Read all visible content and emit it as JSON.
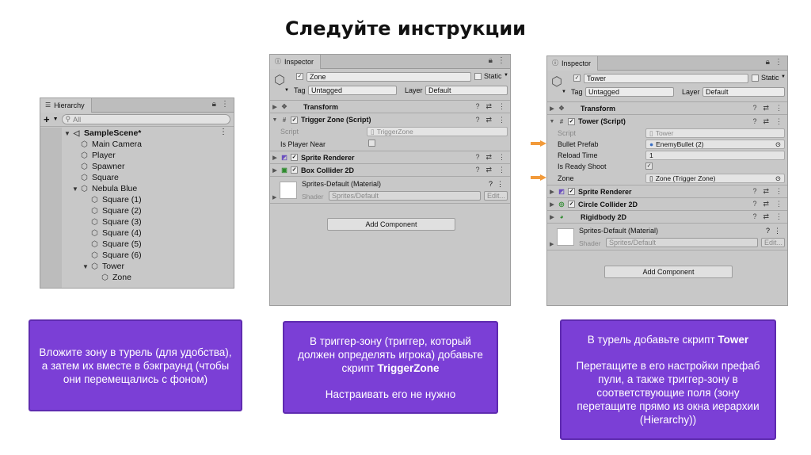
{
  "title": "Следуйте инструкции",
  "hierarchy": {
    "tab_label": "Hierarchy",
    "search_placeholder": "All",
    "items": [
      {
        "label": "SampleScene*"
      },
      {
        "label": "Main Camera"
      },
      {
        "label": "Player"
      },
      {
        "label": "Spawner"
      },
      {
        "label": "Square"
      },
      {
        "label": "Nebula Blue"
      },
      {
        "label": "Square (1)"
      },
      {
        "label": "Square (2)"
      },
      {
        "label": "Square (3)"
      },
      {
        "label": "Square (4)"
      },
      {
        "label": "Square (5)"
      },
      {
        "label": "Square (6)"
      },
      {
        "label": "Tower"
      },
      {
        "label": "Zone"
      }
    ]
  },
  "inspector1": {
    "tab_label": "Inspector",
    "object_name": "Zone",
    "static_label": "Static",
    "tag_label": "Tag",
    "tag_value": "Untagged",
    "layer_label": "Layer",
    "layer_value": "Default",
    "components": {
      "transform": "Transform",
      "trigger_zone": "Trigger Zone (Script)",
      "sprite_renderer": "Sprite Renderer",
      "box_collider": "Box Collider 2D"
    },
    "script_label": "Script",
    "script_value": "TriggerZone",
    "is_player_near_label": "Is Player Near",
    "material_name": "Sprites-Default (Material)",
    "shader_label": "Shader",
    "shader_value": "Sprites/Default",
    "edit_label": "Edit...",
    "add_component": "Add Component"
  },
  "inspector2": {
    "tab_label": "Inspector",
    "object_name": "Tower",
    "static_label": "Static",
    "tag_label": "Tag",
    "tag_value": "Untagged",
    "layer_label": "Layer",
    "layer_value": "Default",
    "components": {
      "transform": "Transform",
      "tower_script": "Tower (Script)",
      "sprite_renderer": "Sprite Renderer",
      "circle_collider": "Circle Collider 2D",
      "rigidbody": "Rigidbody 2D"
    },
    "script_label": "Script",
    "script_value": "Tower",
    "bullet_prefab_label": "Bullet Prefab",
    "bullet_prefab_value": "EnemyBullet (2)",
    "reload_time_label": "Reload Time",
    "reload_time_value": "1",
    "is_ready_shoot_label": "Is Ready Shoot",
    "zone_label": "Zone",
    "zone_value": "Zone (Trigger Zone)",
    "material_name": "Sprites-Default (Material)",
    "shader_label": "Shader",
    "shader_value": "Sprites/Default",
    "edit_label": "Edit...",
    "add_component": "Add Component"
  },
  "callouts": {
    "c1": "Вложите зону в турель (для удобства), а затем их вместе в бэкграунд (чтобы они перемещались с фоном)",
    "c2_line1": "В триггер-зону (триггер, который должен определять игрока) добавьте скрипт ",
    "c2_bold": "TriggerZone",
    "c2_line2": "Настраивать его не нужно",
    "c3_line1": "В турель добавьте скрипт ",
    "c3_bold": "Tower",
    "c3_line2": "Перетащите в его настройки префаб пули, а также триггер-зону в соответствующие поля (зону перетащите прямо из окна иерархии (Hierarchy))"
  },
  "colors": {
    "callout_bg": "#7b3fd6",
    "arrow": "#f29a3a"
  }
}
